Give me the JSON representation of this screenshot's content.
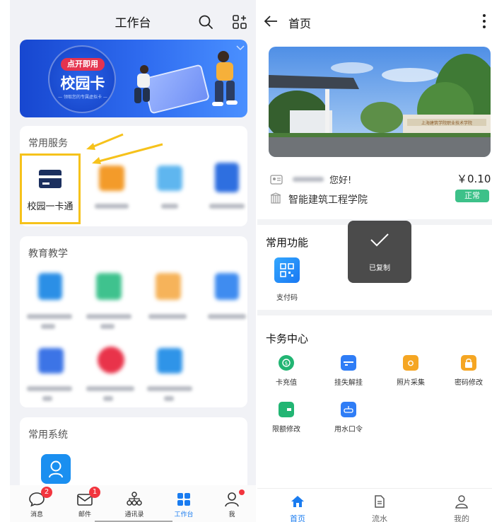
{
  "left_panel": {
    "header": {
      "title": "工作台",
      "search_icon": "search-icon",
      "add_app_icon": "grid-plus-icon"
    },
    "banner": {
      "badge_text": "点开即用",
      "main_text": "校园卡",
      "sub_text": "— 领取您的专属虚拟卡 —",
      "collapse_icon": "chevron-down-icon"
    },
    "common_services": {
      "title": "常用服务",
      "items": [
        {
          "label": "校园一卡通",
          "icon": "card-icon",
          "color": "#1b2f5e"
        }
      ]
    },
    "education": {
      "title": "教育教学"
    },
    "common_systems": {
      "title": "常用系统"
    },
    "bottom_nav": [
      {
        "label": "消息",
        "icon": "message-icon",
        "badge": "2"
      },
      {
        "label": "邮件",
        "icon": "mail-icon",
        "badge": "1"
      },
      {
        "label": "通讯录",
        "icon": "contacts-icon"
      },
      {
        "label": "工作台",
        "icon": "workbench-icon",
        "active": true
      },
      {
        "label": "我",
        "icon": "profile-icon"
      }
    ],
    "accent_color": "#1a7cf0",
    "highlight_color": "#f6c21b"
  },
  "right_panel": {
    "header": {
      "title": "首页",
      "back_icon": "back-arrow-icon",
      "more_icon": "more-vertical-icon"
    },
    "user": {
      "greeting": "您好!",
      "balance": "￥0.10",
      "school": "智能建筑工程学院",
      "status": "正常"
    },
    "photo_sign": "上海建筑学院职业技术学院",
    "common_functions": {
      "title": "常用功能",
      "items": [
        {
          "label": "支付码",
          "icon": "qr-code-icon"
        }
      ]
    },
    "toast": {
      "text": "已复制",
      "icon": "check-icon"
    },
    "card_center": {
      "title": "卡务中心",
      "items": [
        {
          "label": "卡充值",
          "icon": "recharge-icon",
          "color": "#22b573"
        },
        {
          "label": "挂失解挂",
          "icon": "report-loss-icon",
          "color": "#2f7df6"
        },
        {
          "label": "照片采集",
          "icon": "camera-icon",
          "color": "#f5a623"
        },
        {
          "label": "密码修改",
          "icon": "lock-icon",
          "color": "#f5a623"
        },
        {
          "label": "限额修改",
          "icon": "wallet-icon",
          "color": "#22b573"
        },
        {
          "label": "用水口令",
          "icon": "water-icon",
          "color": "#2f7df6"
        }
      ]
    },
    "bottom_nav": [
      {
        "label": "首页",
        "icon": "home-icon",
        "active": true
      },
      {
        "label": "流水",
        "icon": "document-icon"
      },
      {
        "label": "我的",
        "icon": "user-icon"
      }
    ]
  }
}
